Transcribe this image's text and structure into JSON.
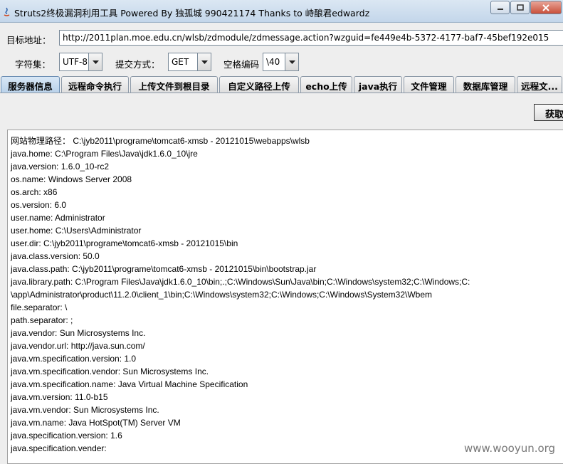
{
  "window": {
    "title": "Struts2终极漏洞利用工具   Powered By 独孤城 990421174 Thanks to 峙酿君edwardz"
  },
  "target": {
    "label": "目标地址：",
    "url": "http://2011plan.moe.edu.cn/wlsb/zdmodule/zdmessage.action?wzguid=fe449e4b-5372-4177-baf7-45bef192e015"
  },
  "options": {
    "charset_label": "字符集：",
    "charset_value": "UTF-8",
    "method_label": "提交方式：",
    "method_value": "GET",
    "space_label": "空格编码",
    "space_value": "\\40"
  },
  "tabs": [
    {
      "label": "服务器信息",
      "active": true
    },
    {
      "label": "远程命令执行",
      "active": false
    },
    {
      "label": "上传文件到根目录",
      "active": false
    },
    {
      "label": "自定义路径上传",
      "active": false
    },
    {
      "label": "echo上传",
      "active": false
    },
    {
      "label": "java执行",
      "active": false
    },
    {
      "label": "文件管理",
      "active": false
    },
    {
      "label": "数据库管理",
      "active": false
    },
    {
      "label": "远程文...",
      "active": false
    }
  ],
  "fetch_button": "获取",
  "output_lines": [
    "网站物理路径：  C:\\jyb2011\\programe\\tomcat6-xmsb - 20121015\\webapps\\wlsb",
    "java.home: C:\\Program Files\\Java\\jdk1.6.0_10\\jre",
    "java.version: 1.6.0_10-rc2",
    "os.name: Windows Server 2008",
    "os.arch: x86",
    "os.version: 6.0",
    "user.name: Administrator",
    "user.home: C:\\Users\\Administrator",
    "user.dir: C:\\jyb2011\\programe\\tomcat6-xmsb - 20121015\\bin",
    "java.class.version: 50.0",
    "java.class.path: C:\\jyb2011\\programe\\tomcat6-xmsb - 20121015\\bin\\bootstrap.jar",
    "java.library.path: C:\\Program Files\\Java\\jdk1.6.0_10\\bin;.;C:\\Windows\\Sun\\Java\\bin;C:\\Windows\\system32;C:\\Windows;C:",
    "\\app\\Administrator\\product\\11.2.0\\client_1\\bin;C:\\Windows\\system32;C:\\Windows;C:\\Windows\\System32\\Wbem",
    "file.separator: \\",
    "path.separator: ;",
    "java.vendor: Sun Microsystems Inc.",
    "java.vendor.url: http://java.sun.com/",
    "java.vm.specification.version: 1.0",
    "java.vm.specification.vendor: Sun Microsystems Inc.",
    "java.vm.specification.name: Java Virtual Machine Specification",
    "java.vm.version: 11.0-b15",
    "java.vm.vendor: Sun Microsystems Inc.",
    "java.vm.name: Java HotSpot(TM) Server VM",
    "java.specification.version: 1.6",
    "java.specification.vender:"
  ],
  "watermark": "www.wooyun.org"
}
